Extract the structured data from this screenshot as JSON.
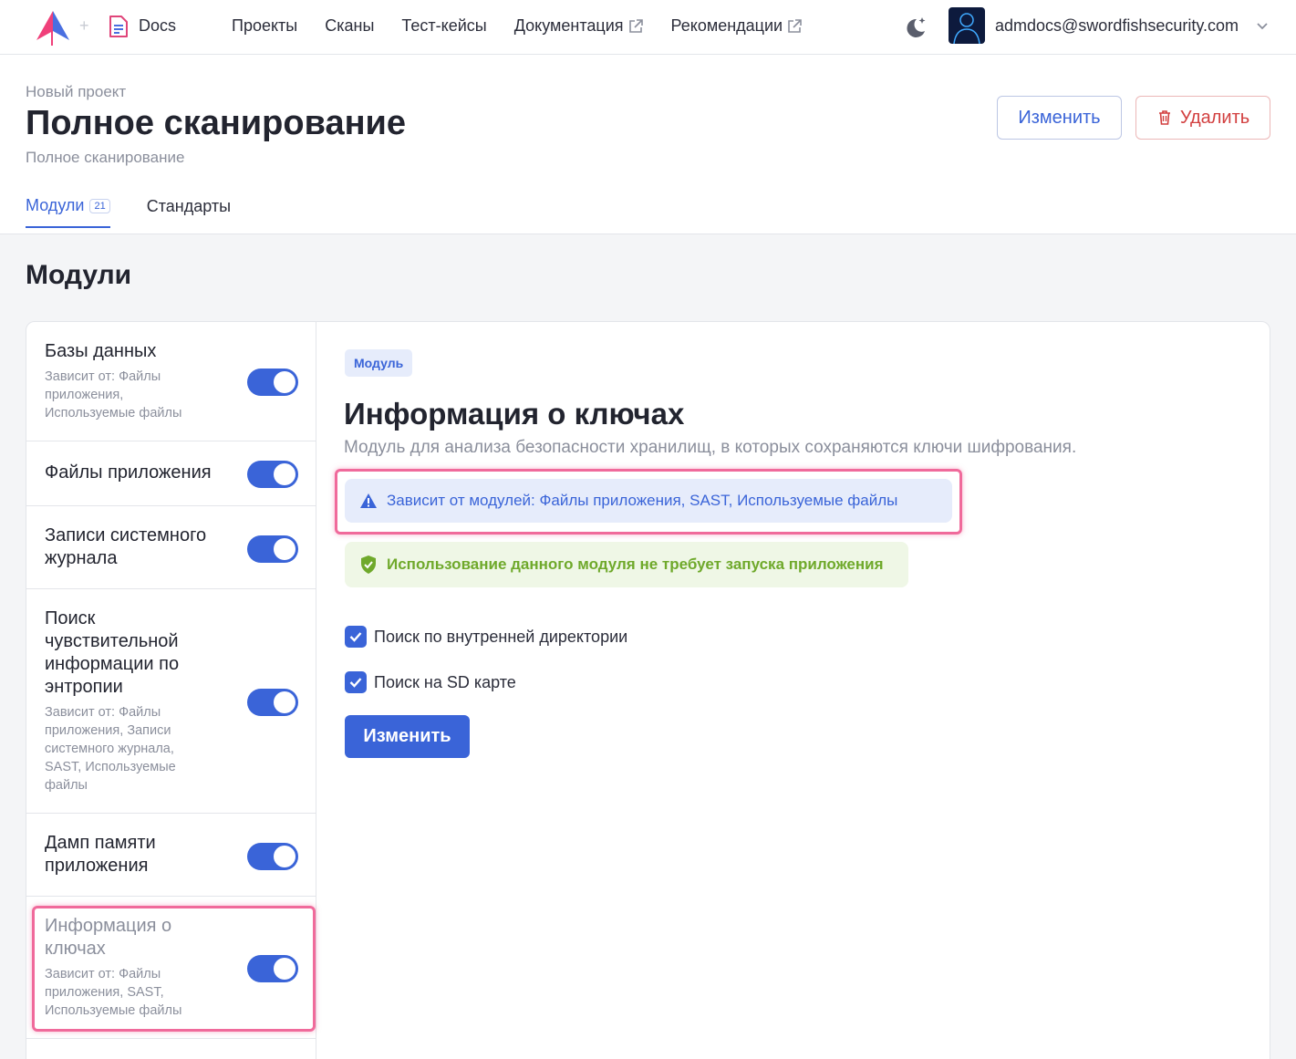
{
  "topbar": {
    "app_label": "Docs",
    "nav": [
      {
        "label": "Проекты",
        "external": false
      },
      {
        "label": "Сканы",
        "external": false
      },
      {
        "label": "Тест-кейсы",
        "external": false
      },
      {
        "label": "Документация",
        "external": true
      },
      {
        "label": "Рекомендации",
        "external": true
      }
    ],
    "user_email": "admdocs@swordfishsecurity.com"
  },
  "header": {
    "breadcrumb": "Новый проект",
    "title": "Полное сканирование",
    "subtitle": "Полное сканирование",
    "edit_label": "Изменить",
    "delete_label": "Удалить",
    "tabs": [
      {
        "label": "Модули",
        "badge": "21",
        "active": true
      },
      {
        "label": "Стандарты",
        "badge": "",
        "active": false
      }
    ]
  },
  "section_title": "Модули",
  "modules": [
    {
      "name": "Базы данных",
      "depends": "Зависит от: Файлы приложения, Используемые файлы",
      "enabled": true,
      "selected": false
    },
    {
      "name": "Файлы приложения",
      "depends": "",
      "enabled": true,
      "selected": false
    },
    {
      "name": "Записи системного журнала",
      "depends": "",
      "enabled": true,
      "selected": false
    },
    {
      "name": "Поиск чувствительной информации по энтропии",
      "depends": "Зависит от: Файлы приложения, Записи системного журнала, SAST, Используемые файлы",
      "enabled": true,
      "selected": false
    },
    {
      "name": "Дамп памяти приложения",
      "depends": "",
      "enabled": true,
      "selected": false
    },
    {
      "name": "Информация о ключах",
      "depends": "Зависит от: Файлы приложения, SAST, Используемые файлы",
      "enabled": true,
      "selected": true
    }
  ],
  "detail": {
    "chip": "Модуль",
    "title": "Информация о ключах",
    "description": "Модуль для анализа безопасности хранилищ, в которых сохраняются ключи шифрования.",
    "depends_alert": "Зависит от модулей: Файлы приложения, SAST, Используемые файлы",
    "no_launch_alert": "Использование данного модуля не требует запуска приложения",
    "options": [
      {
        "label": "Поиск по внутренней директории",
        "checked": true
      },
      {
        "label": "Поиск на SD карте",
        "checked": true
      }
    ],
    "submit_label": "Изменить"
  },
  "colors": {
    "accent": "#3a64d8",
    "danger": "#d23f3f",
    "success": "#6fa92b",
    "highlight": "#f06a9b"
  }
}
